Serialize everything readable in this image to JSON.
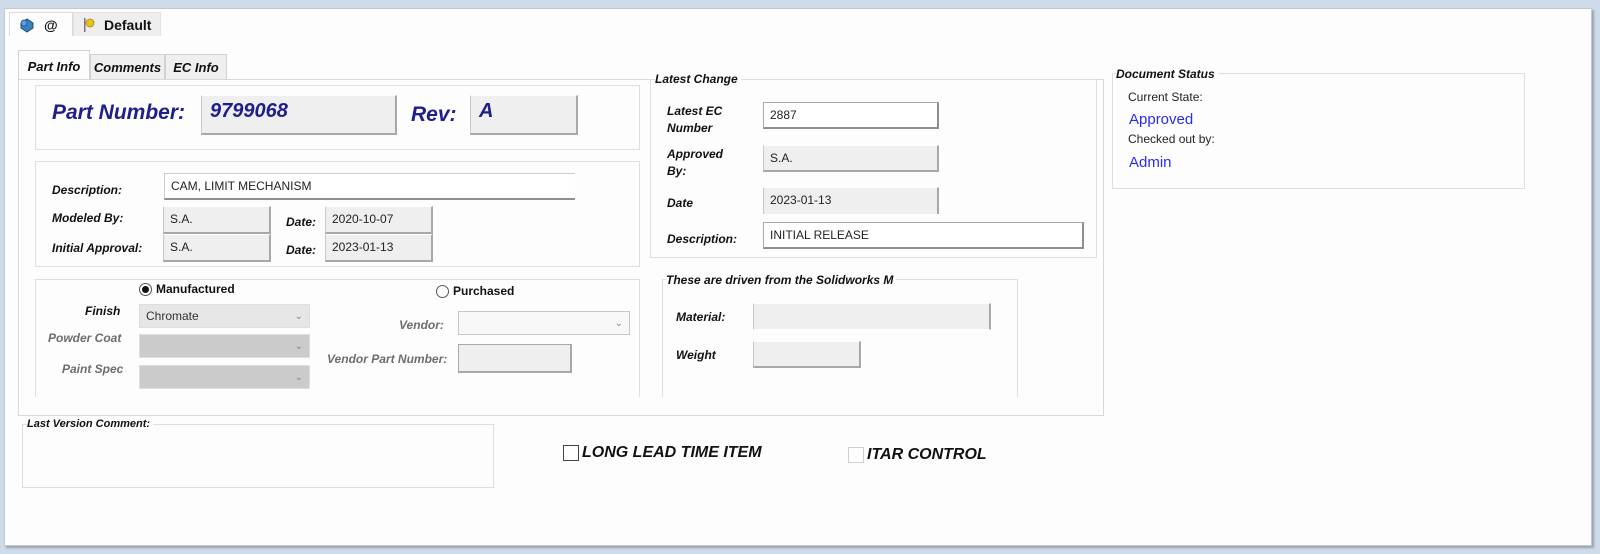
{
  "config_tabs": [
    {
      "label": "@",
      "icon": "part-icon",
      "active": true
    },
    {
      "label": "Default",
      "icon": "config-flag-icon",
      "active": false
    }
  ],
  "sub_tabs": [
    {
      "label": "Part Info",
      "active": true
    },
    {
      "label": "Comments",
      "active": false
    },
    {
      "label": "EC Info",
      "active": false
    }
  ],
  "part": {
    "number_label": "Part Number:",
    "number_value": "9799068",
    "rev_label": "Rev:",
    "rev_value": "A"
  },
  "details": {
    "description_label": "Description:",
    "description_value": "CAM, LIMIT MECHANISM",
    "modeled_by_label": "Modeled By:",
    "modeled_by_value": "S.A.",
    "modeled_date_label": "Date:",
    "modeled_date_value": "2020-10-07",
    "initial_approval_label": "Initial Approval:",
    "initial_approval_value": "S.A.",
    "approval_date_label": "Date:",
    "approval_date_value": "2023-01-13"
  },
  "source": {
    "manufactured_label": "Manufactured",
    "manufactured_selected": true,
    "purchased_label": "Purchased",
    "purchased_selected": false,
    "finish_label": "Finish",
    "finish_value": "Chromate",
    "powder_coat_label": "Powder Coat",
    "powder_coat_value": "",
    "paint_spec_label": "Paint Spec",
    "paint_spec_value": "",
    "vendor_label": "Vendor:",
    "vendor_value": "",
    "vendor_part_label": "Vendor Part Number:",
    "vendor_part_value": ""
  },
  "latest_change": {
    "title": "Latest Change",
    "ec_number_label_1": "Latest EC",
    "ec_number_label_2": "Number",
    "ec_number_value": "2887",
    "approved_by_label_1": "Approved",
    "approved_by_label_2": "By:",
    "approved_by_value": "S.A.",
    "date_label": "Date",
    "date_value": "2023-01-13",
    "description_label": "Description:",
    "description_value": "INITIAL RELEASE"
  },
  "solidworks": {
    "title": "These are driven from the Solidworks M",
    "material_label": "Material:",
    "material_value": "",
    "weight_label": "Weight",
    "weight_value": ""
  },
  "document_status": {
    "title": "Document Status",
    "current_state_label": "Current State:",
    "current_state_value": "Approved",
    "checked_out_label": "Checked out by:",
    "checked_out_value": "Admin",
    "accent_color": "#2b2bef"
  },
  "last_version_comment": {
    "title": "Last Version Comment:",
    "value": ""
  },
  "checkboxes": [
    {
      "label": "LONG LEAD TIME ITEM",
      "checked": false
    },
    {
      "label": "ITAR CONTROL",
      "checked": false
    }
  ]
}
